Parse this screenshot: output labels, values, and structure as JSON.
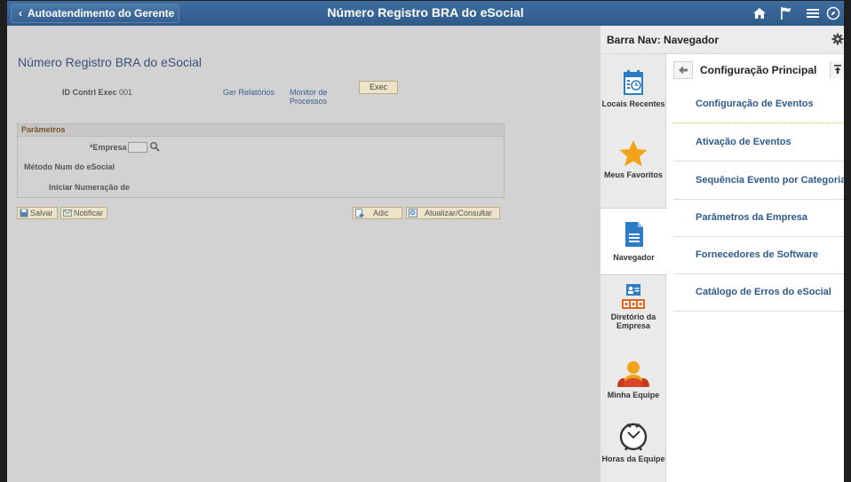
{
  "banner": {
    "back_label": "Autoatendimento do Gerente",
    "title": "Número Registro BRA do eSocial",
    "icons": [
      "home-icon",
      "flag-icon",
      "menu-icon",
      "compass-icon"
    ]
  },
  "main": {
    "page_title": "Número Registro BRA do eSocial",
    "run_control_label": "ID Contrl Exec",
    "run_control_value": "001",
    "links": {
      "report_manager": "Ger Relatórios",
      "process_monitor_line1": "Monitor de",
      "process_monitor_line2": "Processos"
    },
    "exec_button": "Exec",
    "params": {
      "title": "Parâmetros",
      "company_label": "*Empresa",
      "company_value": "",
      "method_label": "Método Num do eSocial",
      "start_label": "Iniciar Numeração de"
    },
    "toolbar": {
      "save": "Salvar",
      "notify": "Notificar",
      "add": "Adic",
      "update": "Atualizar/Consultar"
    }
  },
  "nav": {
    "header_title": "Barra Nav: Navegador",
    "rail": [
      {
        "label": "Locais Recentes",
        "icon": "recent-places-icon"
      },
      {
        "label": "Meus Favoritos",
        "icon": "star-icon"
      },
      {
        "label": "Navegador",
        "icon": "document-icon"
      },
      {
        "label_line1": "Diretório da",
        "label_line2": "Empresa",
        "icon": "directory-icon"
      },
      {
        "label": "Minha Equipe",
        "icon": "team-icon"
      },
      {
        "label": "Horas da Equipe",
        "icon": "clock-person-icon"
      }
    ],
    "list_title": "Configuração Principal",
    "items": [
      "Configuração de Eventos",
      "Ativação de Eventos",
      "Sequência Evento por Categoria",
      "Parâmetros da Empresa",
      "Fornecedores de Software",
      "Catálogo de Erros do eSocial"
    ]
  },
  "colors": {
    "banner": "#2f5b8a",
    "link": "#2e5a8f",
    "section_title": "#7a5530",
    "star": "#f2a31a"
  }
}
